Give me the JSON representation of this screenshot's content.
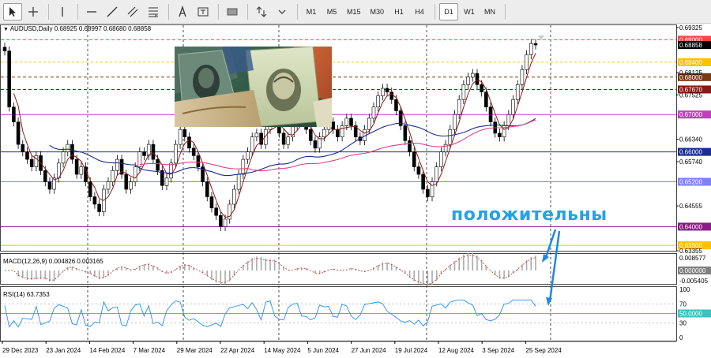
{
  "toolbar": {
    "timeframes": [
      "M1",
      "M5",
      "M15",
      "M30",
      "H1",
      "H4",
      "D1",
      "W1",
      "MN"
    ],
    "active_timeframe": "D1"
  },
  "chart": {
    "header_prefix": "AUDUSD,Daily",
    "ohlc": "0.68925 0.68997 0.68680 0.68858",
    "price_levels": [
      {
        "label": "0.69325",
        "color": "#000000",
        "boxed": false
      },
      {
        "label": "0.69000",
        "color": "#ff4444",
        "boxed": true
      },
      {
        "label": "0.68858",
        "color": "#000000",
        "boxed": true
      },
      {
        "label": "0.68400",
        "color": "#ffc000",
        "boxed": true
      },
      {
        "label": "0.68000",
        "color": "#7a3a14",
        "boxed": true
      },
      {
        "label": "0.68125",
        "color": "#000000",
        "boxed": false
      },
      {
        "label": "0.67670",
        "color": "#8b1a1a",
        "boxed": true
      },
      {
        "label": "0.67525",
        "color": "#000000",
        "boxed": false
      },
      {
        "label": "0.67000",
        "color": "#c040c0",
        "boxed": true
      },
      {
        "label": "0.66340",
        "color": "#000000",
        "boxed": false
      },
      {
        "label": "0.66000",
        "color": "#1a2e8f",
        "boxed": true
      },
      {
        "label": "0.65740",
        "color": "#000000",
        "boxed": false
      },
      {
        "label": "0.65200",
        "color": "#8080ff",
        "boxed": true
      },
      {
        "label": "0.64555",
        "color": "#000000",
        "boxed": false
      },
      {
        "label": "0.64000",
        "color": "#8b1a8b",
        "boxed": true
      },
      {
        "label": "0.63500",
        "color": "#ffc000",
        "boxed": true
      },
      {
        "label": "0.63355",
        "color": "#000000",
        "boxed": false
      }
    ],
    "date_labels": [
      "29 Dec 2023",
      "23 Jan 2024",
      "14 Feb 2024",
      "7 Mar 2024",
      "29 Mar 2024",
      "22 Apr 2024",
      "14 May 2024",
      "5 Jun 2024",
      "27 Jun 2024",
      "19 Jul 2024",
      "12 Aug 2024",
      "3 Sep 2024",
      "25 Sep 2024"
    ],
    "annotation": "положительны",
    "colors": {
      "ma_fast": "#8b1a1a",
      "ma_mid": "#1a2e8f",
      "ma_slow": "#e04080",
      "arrow": "#1e88e5"
    }
  },
  "macd": {
    "label": "MACD(12,26,9) 0.004826 0.003165",
    "scale": [
      "0.008577",
      "0.000000",
      "-0.005405"
    ]
  },
  "rsi": {
    "label": "RSI(14) 63.7353",
    "scale": [
      "100",
      "70",
      "50.0000",
      "30",
      "0"
    ]
  }
}
